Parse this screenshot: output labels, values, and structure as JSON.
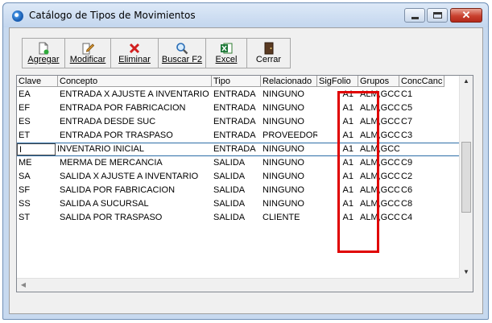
{
  "window": {
    "title": "Catálogo de Tipos de Movimientos"
  },
  "toolbar": {
    "agregar": "Agregar",
    "modificar": "Modificar",
    "eliminar": "Eliminar",
    "buscar": "Buscar F2",
    "excel": "Excel",
    "cerrar": "Cerrar"
  },
  "grid": {
    "columns": [
      "Clave",
      "Concepto",
      "Tipo",
      "Relacionado",
      "SigFolio",
      "Grupos",
      "ConcCanc"
    ],
    "rows": [
      [
        "EA",
        "ENTRADA X AJUSTE A INVENTARIO",
        "ENTRADA",
        "NINGUNO",
        "A1",
        "ALM,GCO",
        "C1"
      ],
      [
        "EF",
        "ENTRADA POR FABRICACION",
        "ENTRADA",
        "NINGUNO",
        "A1",
        "ALM,GCO",
        "C5"
      ],
      [
        "ES",
        "ENTRADA DESDE SUC",
        "ENTRADA",
        "NINGUNO",
        "A1",
        "ALM,GCO",
        "C7"
      ],
      [
        "ET",
        "ENTRADA POR TRASPASO",
        "ENTRADA",
        "PROVEEDOR",
        "A1",
        "ALM,GCO",
        "C3"
      ],
      [
        "I",
        "INVENTARIO INICIAL",
        "ENTRADA",
        "NINGUNO",
        "A1",
        "ALM,GCO",
        ""
      ],
      [
        "ME",
        "MERMA DE MERCANCIA",
        "SALIDA",
        "NINGUNO",
        "A1",
        "ALM,GCO",
        "C9"
      ],
      [
        "SA",
        "SALIDA X AJUSTE A INVENTARIO",
        "SALIDA",
        "NINGUNO",
        "A1",
        "ALM,GCO",
        "C2"
      ],
      [
        "SF",
        "SALIDA POR FABRICACION",
        "SALIDA",
        "NINGUNO",
        "A1",
        "ALM,GCO",
        "C6"
      ],
      [
        "SS",
        "SALIDA A SUCURSAL",
        "SALIDA",
        "NINGUNO",
        "A1",
        "ALM,GCO",
        "C8"
      ],
      [
        "ST",
        "SALIDA POR TRASPASO",
        "SALIDA",
        "CLIENTE",
        "A1",
        "ALM,GCO",
        "C4"
      ]
    ],
    "current_row": 4
  },
  "colors": {
    "highlight": "#e00000",
    "titlebar": "#c7d9ef",
    "close": "#c9412f"
  }
}
